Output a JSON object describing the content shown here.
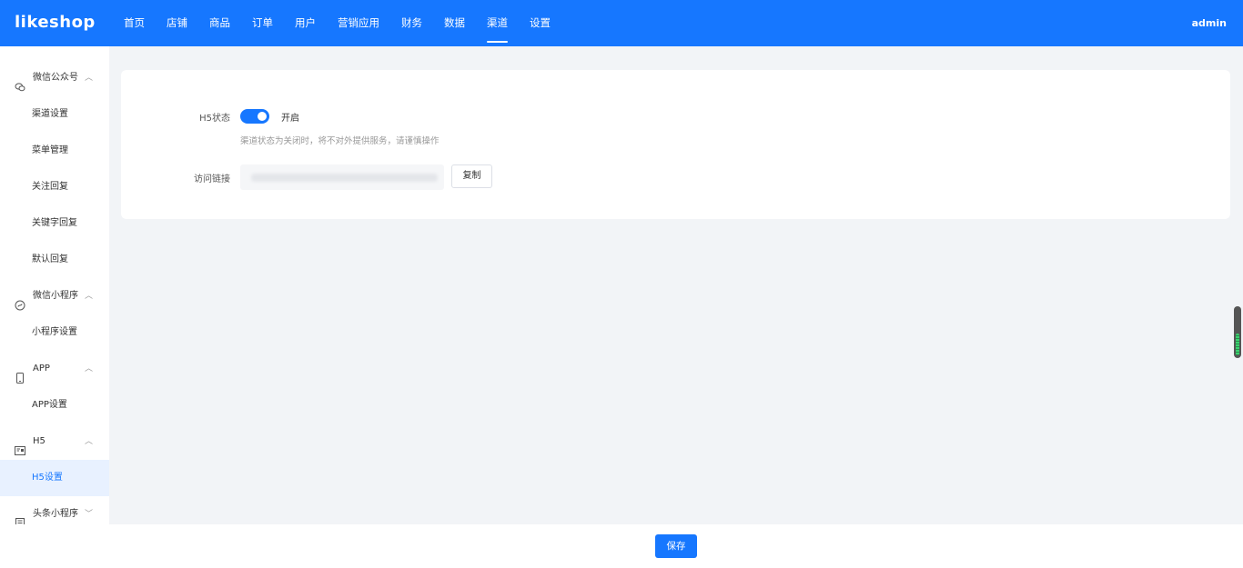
{
  "app": {
    "logo": "likeshop",
    "user": "admin",
    "accent": "#1677ff"
  },
  "nav": {
    "items": [
      "首页",
      "店铺",
      "商品",
      "订单",
      "用户",
      "营销应用",
      "财务",
      "数据",
      "渠道",
      "设置"
    ],
    "active": "渠道"
  },
  "sidebar": {
    "groups": [
      {
        "label": "微信公众号",
        "icon": "wechat-icon",
        "expanded": true,
        "items": [
          "渠道设置",
          "菜单管理",
          "关注回复",
          "关键字回复",
          "默认回复"
        ]
      },
      {
        "label": "微信小程序",
        "icon": "mini-program-icon",
        "expanded": true,
        "items": [
          "小程序设置"
        ]
      },
      {
        "label": "APP",
        "icon": "phone-icon",
        "expanded": true,
        "items": [
          "APP设置"
        ]
      },
      {
        "label": "H5",
        "icon": "h5-icon",
        "expanded": true,
        "items": [
          "H5设置"
        ]
      },
      {
        "label": "头条小程序",
        "icon": "toutiao-icon",
        "expanded": false,
        "items": []
      }
    ],
    "active_item": "H5设置"
  },
  "form": {
    "status_label": "H5状态",
    "status_on": true,
    "status_text": "开启",
    "status_hint": "渠道状态为关闭时，将不对外提供服务，请谨慎操作",
    "link_label": "访问链接",
    "copy_label": "复制"
  },
  "footer": {
    "save_label": "保存"
  }
}
